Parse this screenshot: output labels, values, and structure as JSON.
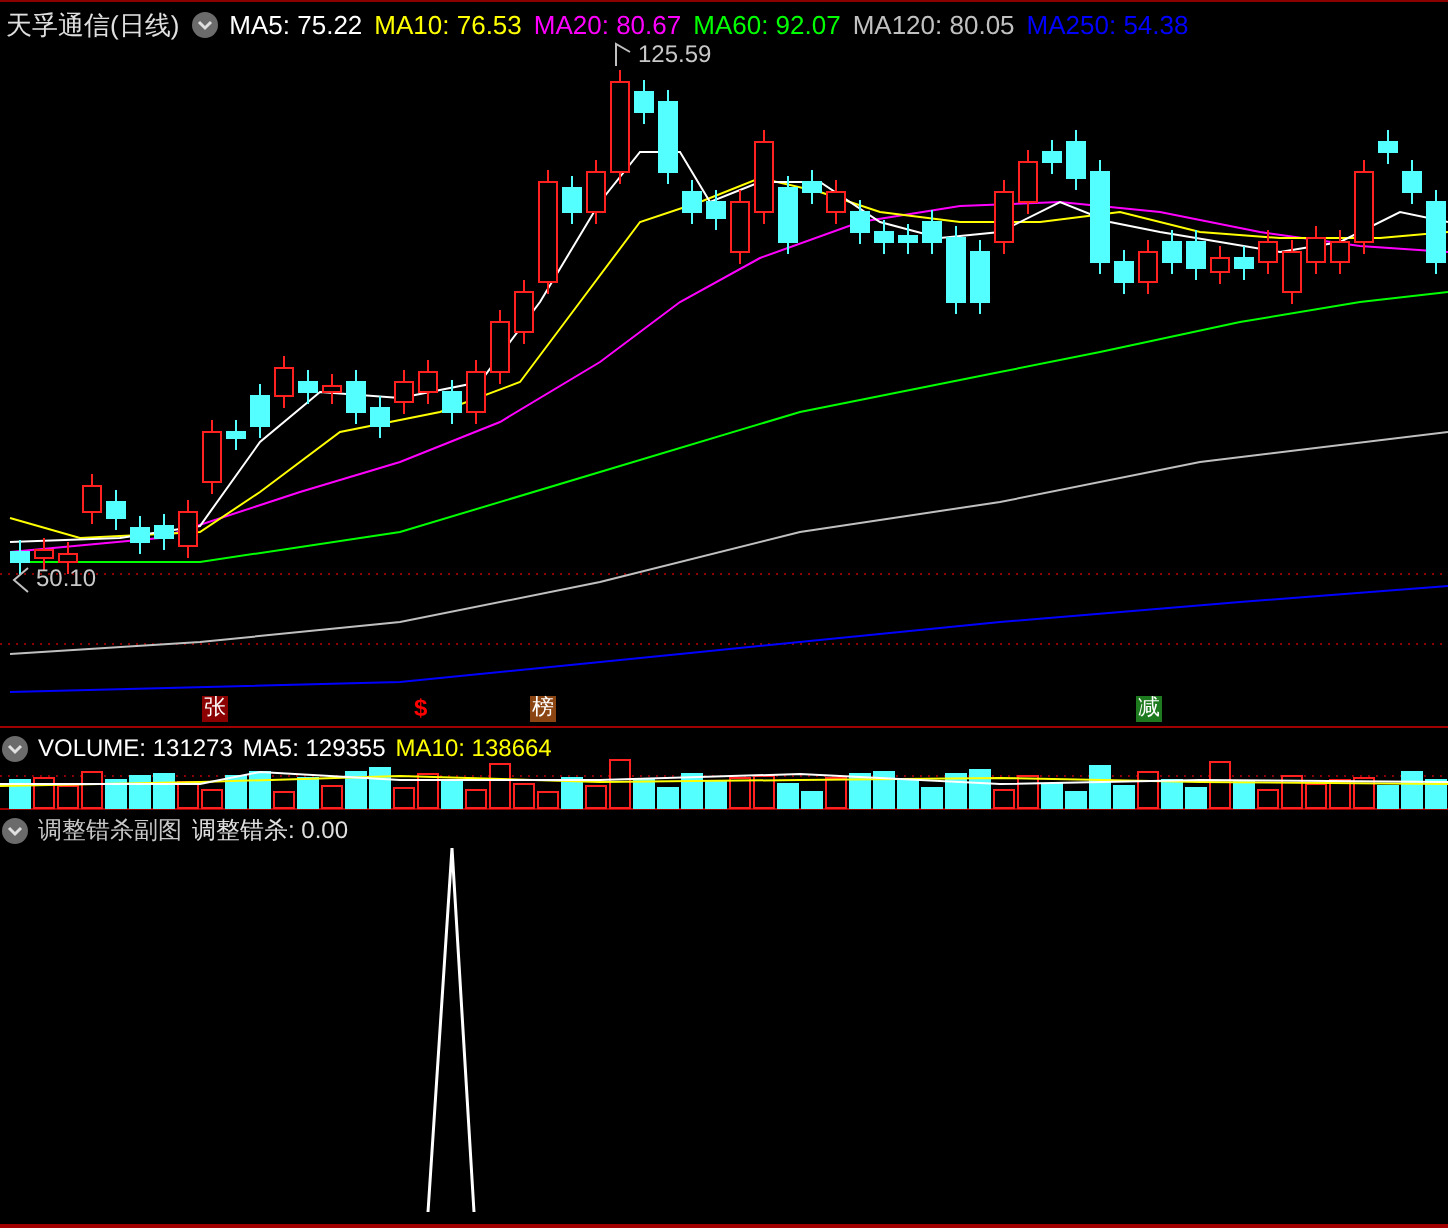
{
  "title": "天孚通信(日线)",
  "ma_legend": [
    {
      "text": "MA5: 75.22",
      "color": "#ffffff"
    },
    {
      "text": "MA10: 76.53",
      "color": "#ffff00"
    },
    {
      "text": "MA20: 80.67",
      "color": "#ff00ff"
    },
    {
      "text": "MA60: 92.07",
      "color": "#00ff00"
    },
    {
      "text": "MA120: 80.05",
      "color": "#c0c0c0"
    },
    {
      "text": "MA250: 54.38",
      "color": "#0000ff"
    }
  ],
  "price_marks": [
    {
      "text": "125.59"
    },
    {
      "text": "50.10"
    }
  ],
  "event_badges": [
    {
      "text": "张",
      "kind": "tile",
      "color": "#8b0000"
    },
    {
      "text": "$",
      "kind": "plain",
      "color": "#ff0000"
    },
    {
      "text": "榜",
      "kind": "tile",
      "color": "#8b4513"
    },
    {
      "text": "减",
      "kind": "tile",
      "color": "#1e7a1e"
    }
  ],
  "volume_legend": [
    {
      "text": "VOLUME: 131273",
      "color": "#ffffff"
    },
    {
      "text": "MA5: 129355",
      "color": "#ffffff"
    },
    {
      "text": "MA10: 138664",
      "color": "#ffff00"
    }
  ],
  "indicator": {
    "title": "调整错杀副图",
    "value": "调整错杀: 0.00"
  }
}
